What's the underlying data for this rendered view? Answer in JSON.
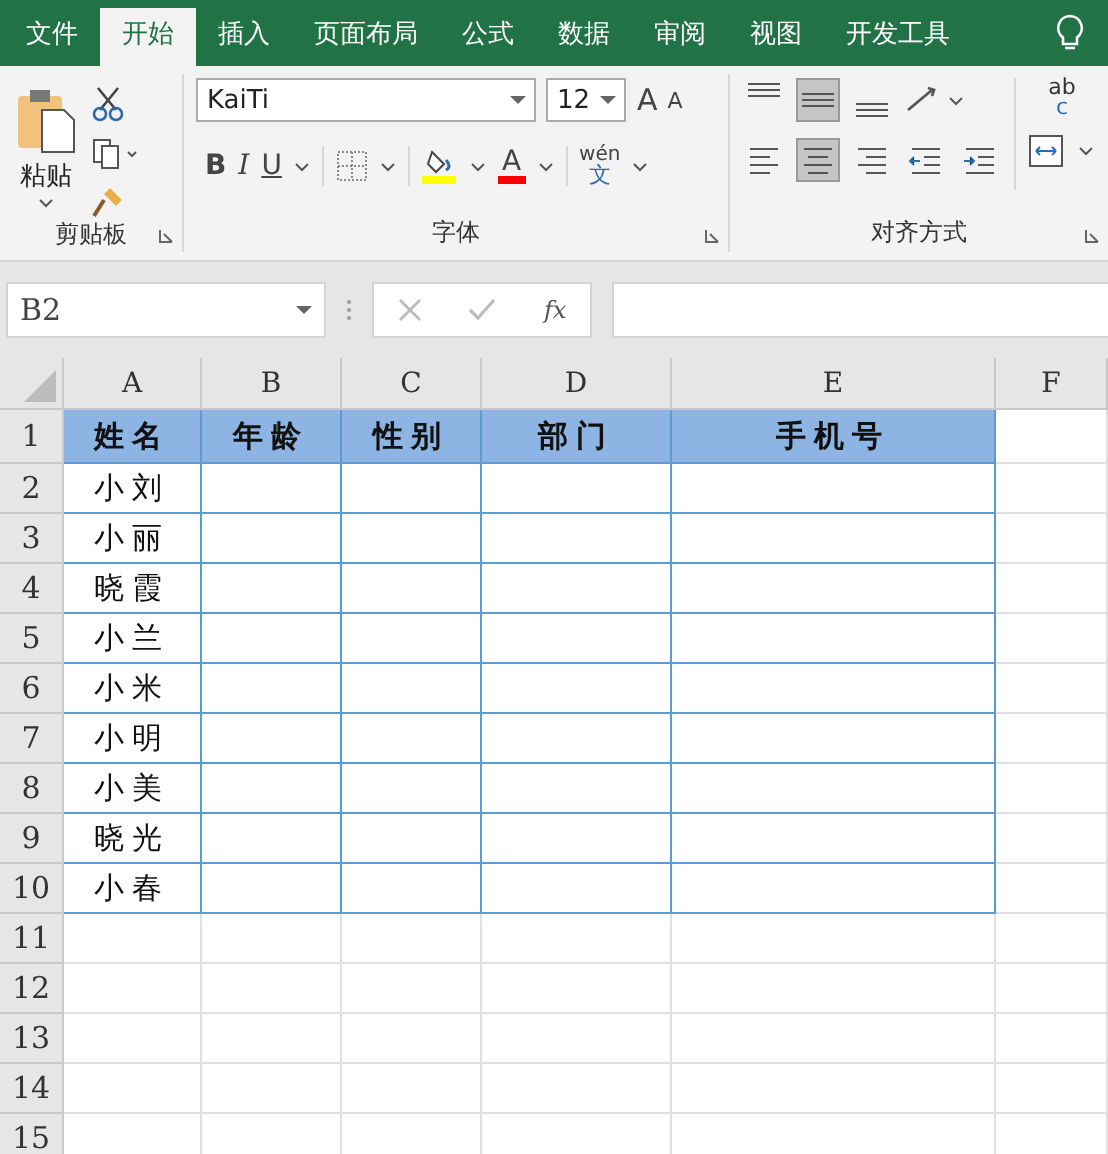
{
  "tabs": [
    {
      "label": "文件",
      "selected": false
    },
    {
      "label": "开始",
      "selected": true
    },
    {
      "label": "插入",
      "selected": false
    },
    {
      "label": "页面布局",
      "selected": false
    },
    {
      "label": "公式",
      "selected": false
    },
    {
      "label": "数据",
      "selected": false
    },
    {
      "label": "审阅",
      "selected": false
    },
    {
      "label": "视图",
      "selected": false
    },
    {
      "label": "开发工具",
      "selected": false
    }
  ],
  "ribbon": {
    "clipboard": {
      "paste": "粘贴",
      "label": "剪贴板"
    },
    "font": {
      "name": "KaiTi",
      "size": "12",
      "grow": "A",
      "shrink": "A",
      "bold": "B",
      "italic": "I",
      "underline": "U",
      "font_color": "A",
      "phonetic_top": "wén",
      "phonetic_bottom": "文",
      "label": "字体"
    },
    "alignment": {
      "label": "对齐方式",
      "wrap_top": "ab",
      "wrap_bottom": "c",
      "vertical": [
        {
          "kind": "top",
          "selected": false
        },
        {
          "kind": "middle",
          "selected": true
        },
        {
          "kind": "bottom",
          "selected": false
        }
      ],
      "horizontal": [
        {
          "kind": "left",
          "selected": false
        },
        {
          "kind": "center",
          "selected": true
        },
        {
          "kind": "right",
          "selected": false
        },
        {
          "kind": "outdent",
          "selected": false
        },
        {
          "kind": "indent",
          "selected": false
        }
      ]
    }
  },
  "formula_bar": {
    "name_box": "B2",
    "fx": "fx"
  },
  "sheet": {
    "columns": [
      "A",
      "B",
      "C",
      "D",
      "E",
      "F"
    ],
    "row_numbers": [
      "1",
      "2",
      "3",
      "4",
      "5",
      "6",
      "7",
      "8",
      "9",
      "10",
      "11",
      "12",
      "13",
      "14",
      "15"
    ],
    "header": [
      "姓名",
      "年龄",
      "性别",
      "部门",
      "手机号"
    ],
    "names": [
      "小刘",
      "小丽",
      "晓霞",
      "小兰",
      "小米",
      "小明",
      "小美",
      "晓光",
      "小春"
    ]
  }
}
